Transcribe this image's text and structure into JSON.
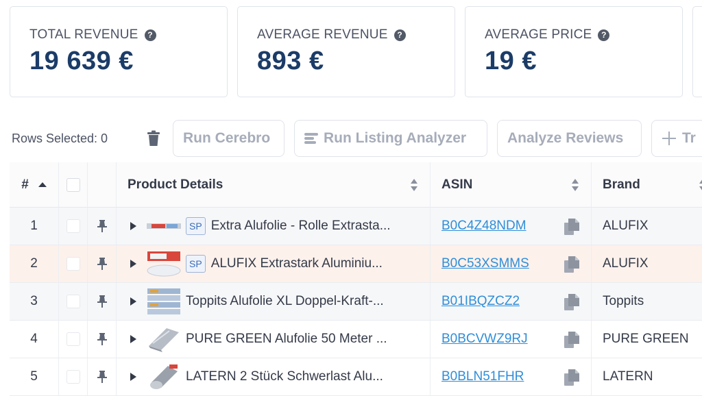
{
  "metrics": [
    {
      "label": "TOTAL REVENUE",
      "value": "19 639 €"
    },
    {
      "label": "AVERAGE REVENUE",
      "value": "893 €"
    },
    {
      "label": "AVERAGE PRICE",
      "value": "19 €"
    }
  ],
  "toolbar": {
    "rows_selected": "Rows Selected: 0",
    "buttons": [
      "Run Cerebro",
      "Run Listing Analyzer",
      "Analyze Reviews",
      "Tr"
    ]
  },
  "table": {
    "headers": {
      "num": "#",
      "product": "Product Details",
      "asin": "ASIN",
      "brand": "Brand"
    },
    "rows": [
      {
        "num": "1",
        "sp": "SP",
        "title": "Extra Alufolie - Rolle Extrasta...",
        "asin": "B0C4Z48NDM",
        "brand": "ALUFIX",
        "highlight": false
      },
      {
        "num": "2",
        "sp": "SP",
        "title": "ALUFIX Extrastark Aluminiu...",
        "asin": "B0C53XSMMS",
        "brand": "ALUFIX",
        "highlight": true
      },
      {
        "num": "3",
        "sp": "",
        "title": "Toppits Alufolie XL Doppel-Kraft-...",
        "asin": "B01IBQZCZ2",
        "brand": "Toppits",
        "highlight": false
      },
      {
        "num": "4",
        "sp": "",
        "title": "PURE GREEN Alufolie 50 Meter ...",
        "asin": "B0BCVWZ9RJ",
        "brand": "PURE GREEN",
        "highlight": false
      },
      {
        "num": "5",
        "sp": "",
        "title": "LATERN 2 Stück Schwerlast Alu...",
        "asin": "B0BLN51FHR",
        "brand": "LATERN",
        "highlight": false
      }
    ]
  },
  "colors": {
    "highlight_row": "#fdf1ec",
    "alt_row": "#f6f7f9",
    "value_text": "#1c3c68",
    "link": "#2f8ed8"
  }
}
